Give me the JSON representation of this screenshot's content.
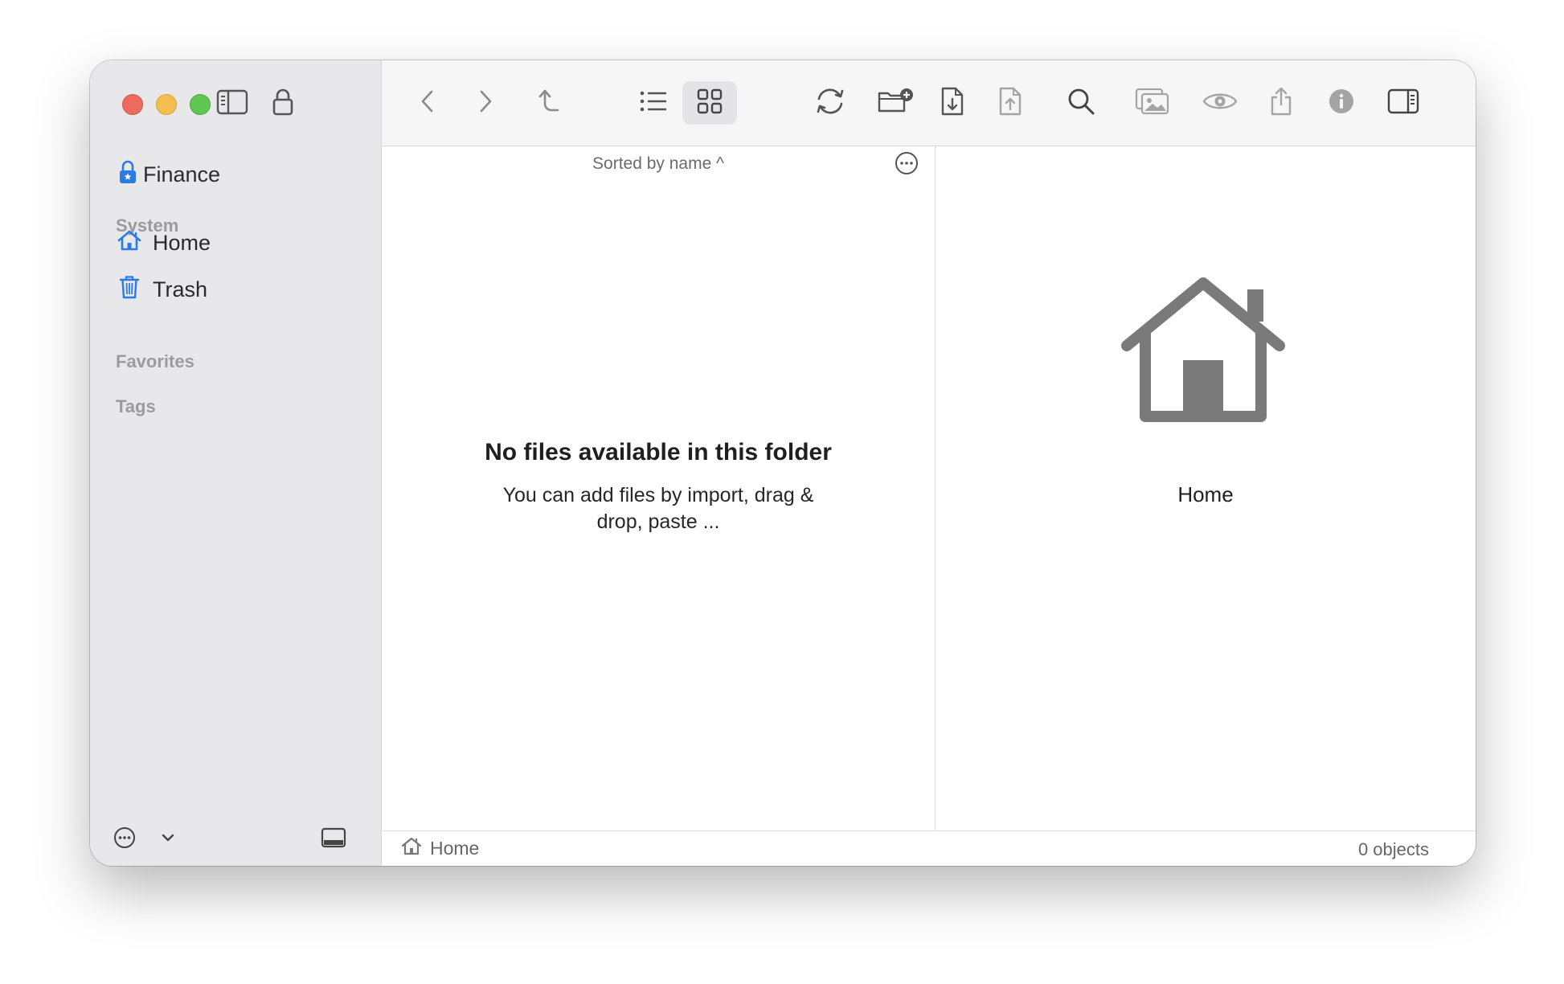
{
  "sidebar": {
    "vault": {
      "label": "Finance",
      "icon": "lock-icon"
    },
    "sections": {
      "system": "System",
      "favorites": "Favorites",
      "tags": "Tags"
    },
    "items": [
      {
        "label": "Home",
        "icon": "house-icon"
      },
      {
        "label": "Trash",
        "icon": "trash-icon"
      }
    ]
  },
  "toolbar": {
    "icons": [
      "back-icon",
      "forward-icon",
      "parent-folder-icon",
      "list-view-icon",
      "grid-view-icon",
      "refresh-icon",
      "new-folder-icon",
      "import-icon",
      "export-icon",
      "search-icon",
      "photos-icon",
      "quick-look-icon",
      "share-icon",
      "info-icon",
      "inspector-toggle-icon"
    ],
    "active_view": "grid"
  },
  "filelist": {
    "sort_label": "Sorted by name ^",
    "empty_title": "No files available in this folder",
    "empty_subtitle": "You can add files by import, drag & drop, paste ..."
  },
  "preview": {
    "label": "Home"
  },
  "statusbar": {
    "path": "Home",
    "count": "0 objects"
  },
  "colors": {
    "accent": "#2a7be4",
    "icon_gray": "#6e6e6e",
    "preview_icon": "#7a7a7a"
  }
}
